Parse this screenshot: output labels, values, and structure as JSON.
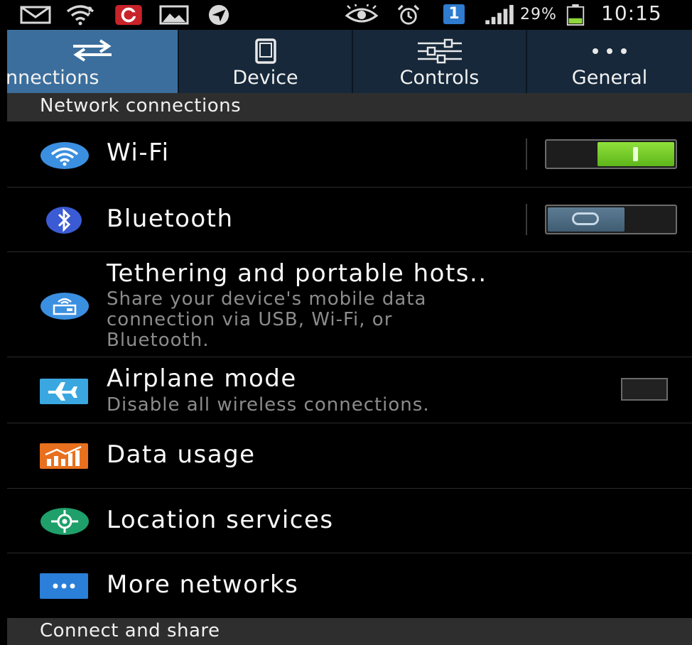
{
  "status_bar": {
    "icons_left": [
      "mail-icon",
      "wifi-alert-icon",
      "app-badge-icon",
      "image-icon",
      "location-arrow-icon"
    ],
    "icons_right": [
      "eye-icon",
      "alarm-icon",
      "notification-count-icon",
      "signal-icon",
      "battery-icon"
    ],
    "notification_count": "1",
    "battery": "29%",
    "time": "10:15"
  },
  "tabs": [
    {
      "label": "Connections",
      "icon": "swap-arrows-icon",
      "active": true
    },
    {
      "label": "Device",
      "icon": "phone-icon",
      "active": false
    },
    {
      "label": "Controls",
      "icon": "sliders-icon",
      "active": false
    },
    {
      "label": "General",
      "icon": "more-dots-icon",
      "active": false
    }
  ],
  "tab_visible_label": "nnections",
  "sections": {
    "network": "Network connections",
    "share": "Connect and share"
  },
  "rows": {
    "wifi": {
      "title": "Wi-Fi",
      "icon": "wifi-icon",
      "switch": "on"
    },
    "bluetooth": {
      "title": "Bluetooth",
      "icon": "bluetooth-icon",
      "switch": "off"
    },
    "tethering": {
      "title": "Tethering and portable hots..",
      "subtitle_1": "Share your device's mobile data",
      "subtitle_2": "connection via USB, Wi-Fi, or",
      "subtitle_3": "Bluetooth.",
      "icon": "hotspot-icon"
    },
    "airplane": {
      "title": "Airplane mode",
      "subtitle": "Disable all wireless connections.",
      "icon": "airplane-icon",
      "checked": false
    },
    "data_usage": {
      "title": "Data usage",
      "icon": "data-usage-icon"
    },
    "location": {
      "title": "Location services",
      "icon": "location-target-icon"
    },
    "more": {
      "title": "More networks",
      "icon": "more-networks-icon"
    }
  },
  "colors": {
    "tab_active": "#3b6e9c",
    "tab_bg": "#16283a",
    "switch_on": "#6fc527",
    "switch_off": "#4e6e86",
    "section_bg": "#2e2e2e"
  }
}
